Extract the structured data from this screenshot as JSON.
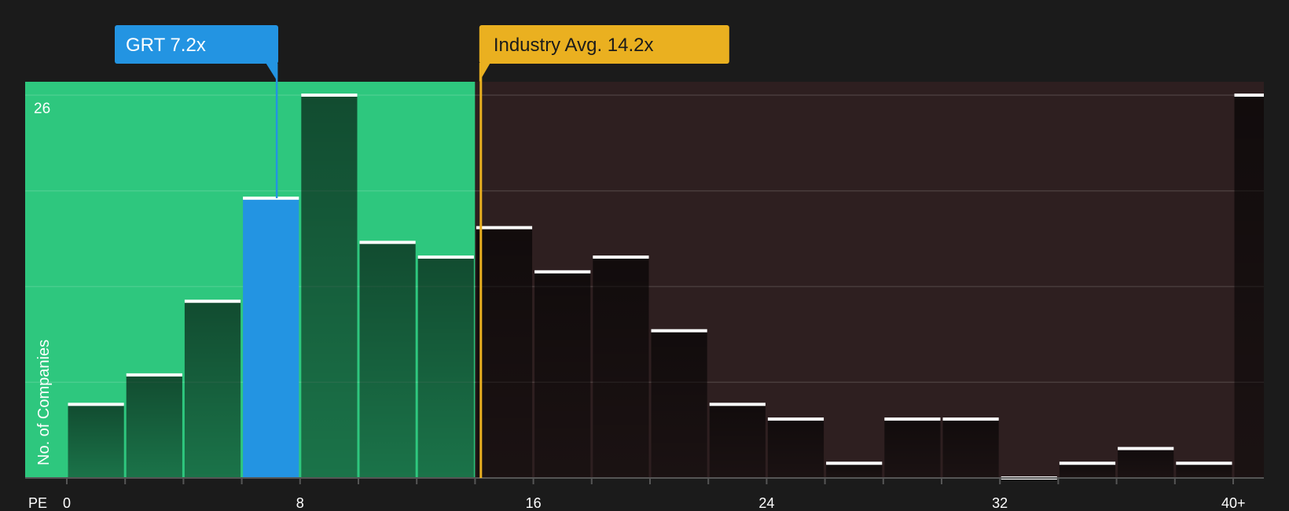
{
  "chart_data": {
    "type": "bar",
    "xlabel": "PE",
    "ylabel": "No. of Companies",
    "ylim": [
      0,
      26
    ],
    "y_top_label": "26",
    "x_ticks": [
      {
        "value": 0,
        "label": "0"
      },
      {
        "value": 8,
        "label": "8"
      },
      {
        "value": 16,
        "label": "16"
      },
      {
        "value": 24,
        "label": "24"
      },
      {
        "value": 32,
        "label": "32"
      },
      {
        "value": 40,
        "label": "40+"
      }
    ],
    "bins": [
      {
        "x0": 0,
        "x1": 2,
        "value": 5
      },
      {
        "x0": 2,
        "x1": 4,
        "value": 7
      },
      {
        "x0": 4,
        "x1": 6,
        "value": 12
      },
      {
        "x0": 6,
        "x1": 8,
        "value": 19,
        "highlight": true
      },
      {
        "x0": 8,
        "x1": 10,
        "value": 26
      },
      {
        "x0": 10,
        "x1": 12,
        "value": 16
      },
      {
        "x0": 12,
        "x1": 14,
        "value": 15
      },
      {
        "x0": 14,
        "x1": 16,
        "value": 17
      },
      {
        "x0": 16,
        "x1": 18,
        "value": 14
      },
      {
        "x0": 18,
        "x1": 20,
        "value": 15
      },
      {
        "x0": 20,
        "x1": 22,
        "value": 10
      },
      {
        "x0": 22,
        "x1": 24,
        "value": 5
      },
      {
        "x0": 24,
        "x1": 26,
        "value": 4
      },
      {
        "x0": 26,
        "x1": 28,
        "value": 1
      },
      {
        "x0": 28,
        "x1": 30,
        "value": 4
      },
      {
        "x0": 30,
        "x1": 32,
        "value": 4
      },
      {
        "x0": 32,
        "x1": 34,
        "value": 0
      },
      {
        "x0": 34,
        "x1": 36,
        "value": 1
      },
      {
        "x0": 36,
        "x1": 38,
        "value": 2
      },
      {
        "x0": 38,
        "x1": 40,
        "value": 1
      },
      {
        "x0": 40,
        "x1": 41,
        "value": 26
      }
    ],
    "company": {
      "label": "GRT 7.2x",
      "value": 7.2
    },
    "industry": {
      "label": "Industry Avg. 14.2x",
      "value": 14.2
    },
    "colors": {
      "background": "#1b1b1b",
      "green_zone": "#2ec77e",
      "red_zone": "#2e1f20",
      "bar": "#222222",
      "highlight": "#2394e2",
      "industry": "#eab020",
      "cap": "#ffffff"
    }
  }
}
